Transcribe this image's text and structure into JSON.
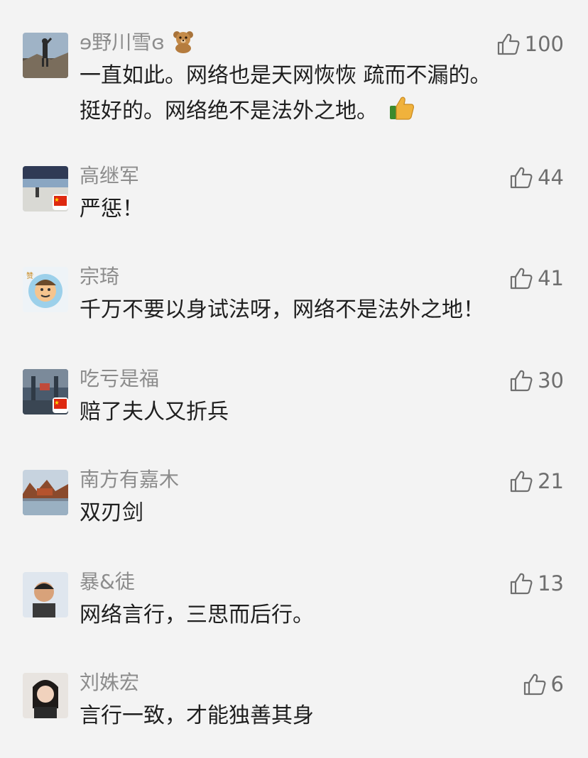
{
  "comments": [
    {
      "name_prefix": "ɘ野川雪ɞ",
      "name_emoji": "bear-emoji",
      "likes": "100",
      "line1": "一直如此。网络也是天网恢恢 疏而不漏的。",
      "line2": "挺好的。网络绝不是法外之地。",
      "text_emoji": "thumbs-up-emoji",
      "flag": false
    },
    {
      "name": "高继军",
      "likes": "44",
      "line1": "严惩！",
      "flag": true
    },
    {
      "name": "宗琦",
      "likes": "41",
      "line1": "千万不要以身试法呀，网络不是法外之地！",
      "flag": false
    },
    {
      "name": "吃亏是福",
      "likes": "30",
      "line1": "赔了夫人又折兵",
      "flag": true
    },
    {
      "name": "南方有嘉木",
      "likes": "21",
      "line1": "双刃剑",
      "flag": false
    },
    {
      "name": "暴&徒",
      "likes": "13",
      "line1": "网络言行，三思而后行。",
      "flag": false
    },
    {
      "name": "刘姝宏",
      "likes": "6",
      "line1": "言行一致，才能独善其身",
      "flag": false
    }
  ],
  "icons": {
    "like": "thumbs-up-outline-icon",
    "flag": "china-flag-icon"
  },
  "colors": {
    "background": "#f3f3f3",
    "name": "#8c8c8c",
    "text": "#1f1f1f",
    "like": "#6f6f6f"
  }
}
